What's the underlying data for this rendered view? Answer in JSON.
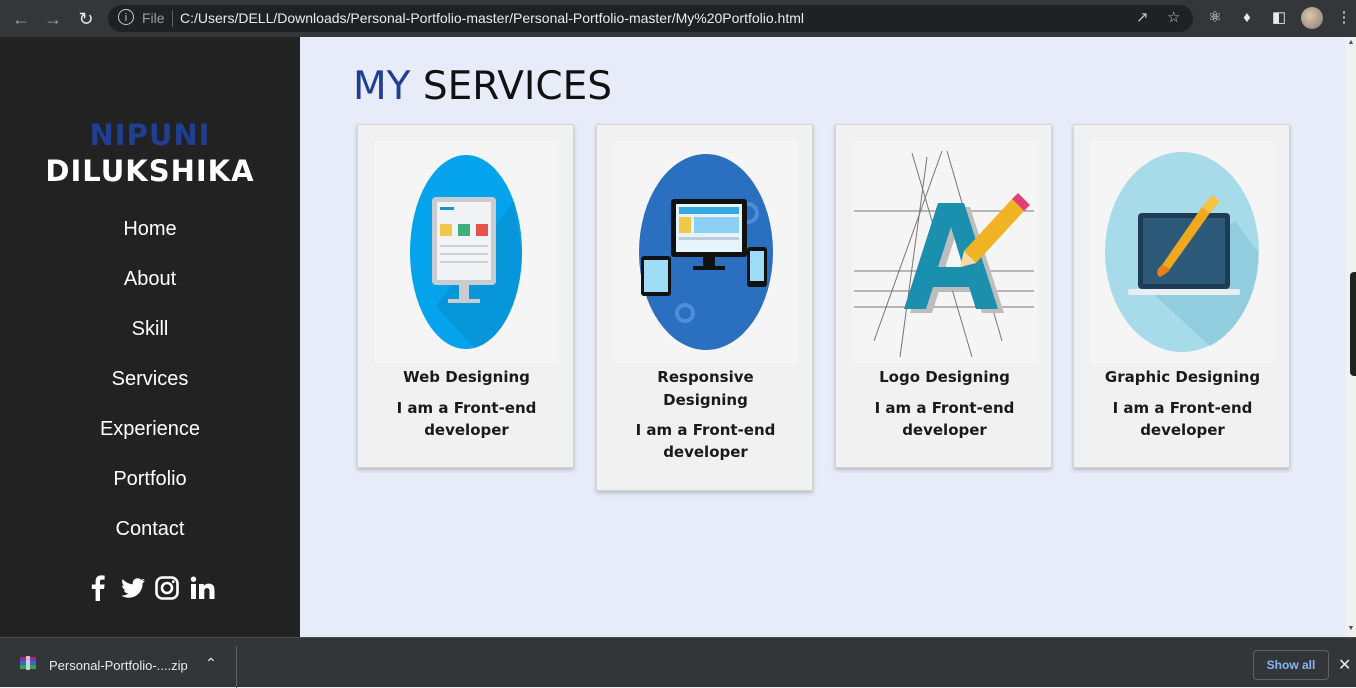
{
  "browser": {
    "protocol_label": "File",
    "url": "C:/Users/DELL/Downloads/Personal-Portfolio-master/Personal-Portfolio-master/My%20Portfolio.html"
  },
  "sidebar": {
    "first_name": "NIPUNI",
    "last_name": "DILUKSHIKA",
    "nav": [
      "Home",
      "About",
      "Skill",
      "Services",
      "Experience",
      "Portfolio",
      "Contact"
    ],
    "socials": [
      "facebook-icon",
      "twitter-icon",
      "instagram-icon",
      "linkedin-icon"
    ]
  },
  "main": {
    "title_prefix": "MY",
    "title_rest": "SERVICES",
    "cards": [
      {
        "title": "Web Designing",
        "desc": "I am a Front-end developer"
      },
      {
        "title": "Responsive Designing",
        "desc": "I am a Front-end developer"
      },
      {
        "title": "Logo Designing",
        "desc": "I am a Front-end developer"
      },
      {
        "title": "Graphic Designing",
        "desc": "I am a Front-end developer"
      }
    ]
  },
  "downloads": {
    "file_name": "Personal-Portfolio-....zip",
    "show_all": "Show all"
  },
  "colors": {
    "accent": "#203f91",
    "sidebar_bg": "#222222",
    "main_bg": "#e7ecf8"
  }
}
